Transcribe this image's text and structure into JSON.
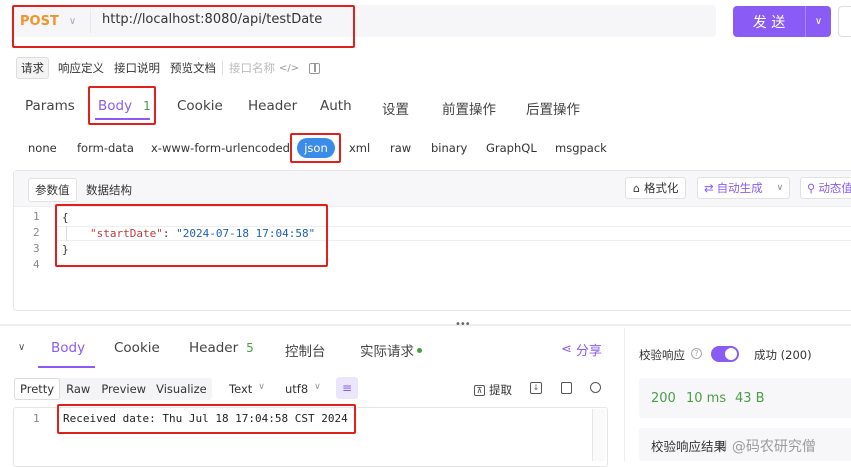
{
  "request": {
    "method": "POST",
    "url": "http://localhost:8080/api/testDate",
    "send_label": "发 送"
  },
  "mode_tabs": [
    "请求",
    "响应定义",
    "接口说明",
    "预览文档"
  ],
  "interface_name_placeholder": "接口名称",
  "req_tabs": [
    {
      "label": "Params"
    },
    {
      "label": "Body",
      "badge": "1"
    },
    {
      "label": "Cookie"
    },
    {
      "label": "Header"
    },
    {
      "label": "Auth"
    },
    {
      "label": "设置"
    },
    {
      "label": "前置操作"
    },
    {
      "label": "后置操作"
    }
  ],
  "body_types": [
    "none",
    "form-data",
    "x-www-form-urlencoded",
    "json",
    "xml",
    "raw",
    "binary",
    "GraphQL",
    "msgpack"
  ],
  "body_subtabs": [
    "参数值",
    "数据结构"
  ],
  "body_actions": {
    "format": "格式化",
    "autogen": "自动生成",
    "dynamic": "动态值"
  },
  "editor_lines": [
    "1",
    "2",
    "3",
    "4"
  ],
  "json_body": {
    "open": "{",
    "key": "\"startDate\"",
    "colon": ":",
    "value": "\"2024-07-18 17:04:58\"",
    "close": "}"
  },
  "resp_tabs": [
    {
      "label": "Body"
    },
    {
      "label": "Cookie"
    },
    {
      "label": "Header",
      "badge": "5"
    },
    {
      "label": "控制台"
    },
    {
      "label": "实际请求"
    }
  ],
  "share_label": "分享",
  "view_modes": [
    "Pretty",
    "Raw",
    "Preview",
    "Visualize"
  ],
  "text_select": "Text",
  "encoding_select": "utf8",
  "extract_label": "提取",
  "resp_line_no": "1",
  "response_text": "Received date: Thu Jul 18 17:04:58 CST 2024",
  "validation": {
    "label": "校验响应",
    "result": "成功 (200)",
    "status": "200",
    "time": "10 ms",
    "size": "43 B",
    "summary": "校验响应结果"
  },
  "watermark": "N @码农研究僧",
  "colors": {
    "accent": "#8a5cf5",
    "method": "#f0932b",
    "highlight": "#e0201c",
    "json_key": "#c23a3a",
    "json_value": "#1d5fb5",
    "success": "#4a9e48"
  }
}
